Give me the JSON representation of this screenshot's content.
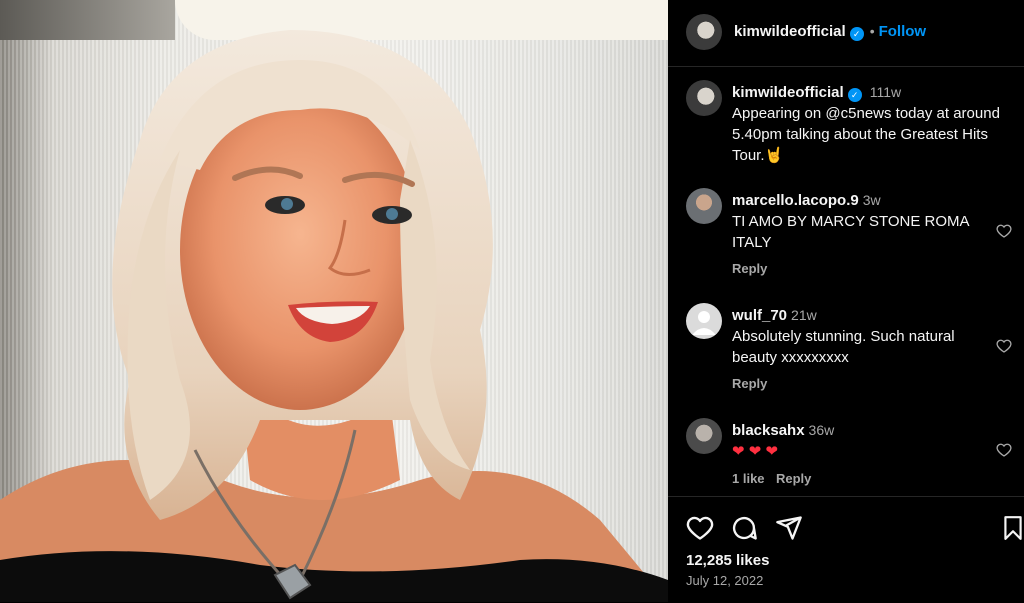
{
  "post": {
    "author": "kimwildeofficial",
    "follow_label": "Follow",
    "separator": "•",
    "caption_time": "111w",
    "caption": "Appearing on @c5news today at around 5.40pm talking about the Greatest Hits Tour.🤘",
    "likes": "12,285 likes",
    "date": "July 12, 2022"
  },
  "comments": [
    {
      "user": "marcello.lacopo.9",
      "time": "3w",
      "text": "TI AMO BY MARCY STONE ROMA ITALY",
      "reply": "Reply"
    },
    {
      "user": "wulf_70",
      "time": "21w",
      "text": "Absolutely stunning. Such natural beauty xxxxxxxxx",
      "reply": "Reply"
    },
    {
      "user": "blacksahx",
      "time": "36w",
      "text": "❤ ❤ ❤",
      "like_count": "1 like",
      "reply": "Reply"
    }
  ],
  "colors": {
    "accent": "#0095f6",
    "background": "#000000",
    "muted": "#a8a8a8",
    "heart": "#ff3040"
  },
  "icons": [
    "verified-badge-icon",
    "heart-icon",
    "comment-icon",
    "share-icon",
    "bookmark-icon"
  ]
}
